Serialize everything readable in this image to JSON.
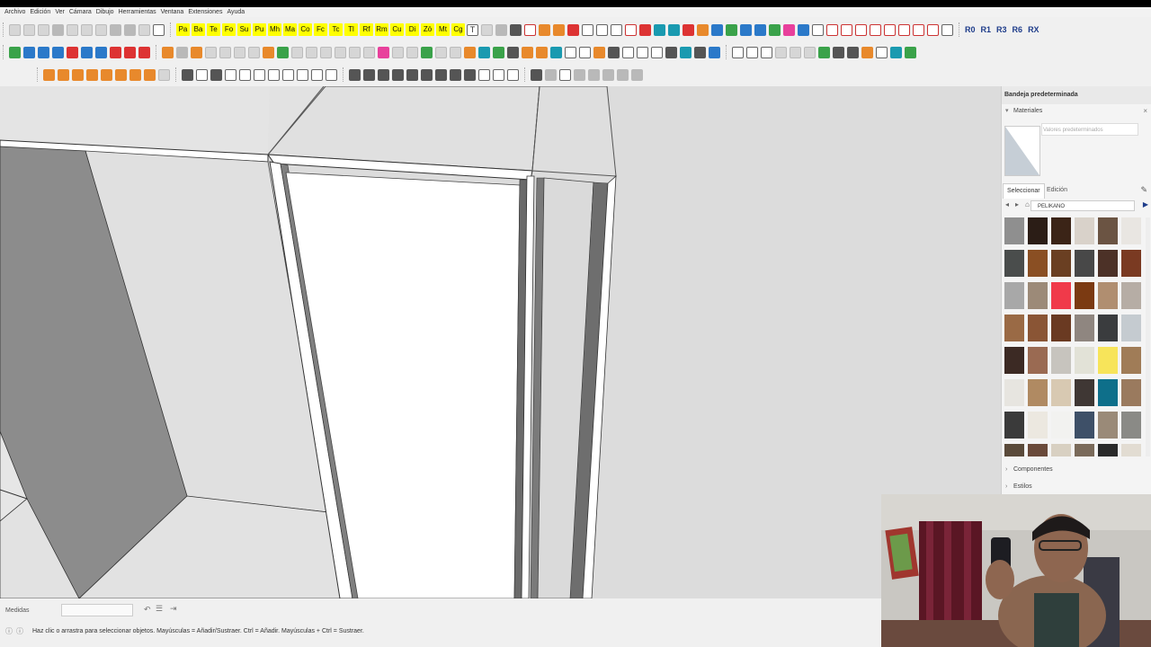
{
  "menu": [
    "Archivo",
    "Edición",
    "Ver",
    "Cámara",
    "Dibujo",
    "Herramientas",
    "Ventana",
    "Extensiones",
    "Ayuda"
  ],
  "toolbar": {
    "plugin_buttons": [
      "Pa",
      "Ba",
      "Te",
      "Fo",
      "Su",
      "Pu",
      "Mh",
      "Ma",
      "Co",
      "Fc",
      "Tc",
      "Tl",
      "Rf",
      "Rm",
      "Cu",
      "Di",
      "Zö",
      "Mt",
      "Cg"
    ],
    "text_tool_label": "T",
    "right_buttons": [
      "R0",
      "R1",
      "R3",
      "R6",
      "RX"
    ]
  },
  "tray": {
    "title": "Bandeja predeterminada",
    "materials_section": "Materiales",
    "material_name_placeholder": "Valores predeterminados",
    "tab_select": "Seleccionar",
    "tab_edit": "Edición",
    "library": "PELIKANO",
    "components_section": "Componentes",
    "styles_section": "Estilos",
    "swatches": [
      "#8f8f8f",
      "#2b1d16",
      "#3b2417",
      "#d9d2ca",
      "#6b5443",
      "#e9e6e2",
      "#4a4d4c",
      "#8a4f23",
      "#6a3f22",
      "#484848",
      "#4c3127",
      "#7a3a22",
      "#a8a8a8",
      "#9c8a78",
      "#f03a4a",
      "#7b3a12",
      "#b08e70",
      "#b6ada5",
      "#9a6a45",
      "#8a5535",
      "#6a3a22",
      "#8f8680",
      "#3a3c3e",
      "#c5cbd0",
      "#3c2a24",
      "#9a6a52",
      "#c7c4be",
      "#e2e2d7",
      "#f7e45a",
      "#a07c57",
      "#e7e5e0",
      "#b08a62",
      "#d8c9b2",
      "#3f3734",
      "#0e6f8a",
      "#9a7a5e",
      "#3a3a3a",
      "#ece8e0",
      "#f2f2f0",
      "#3e5068",
      "#9a8a78",
      "#8a8a86",
      "#5a4a3a",
      "#6a4a3a",
      "#d8d0c2",
      "#7a6a5a",
      "#2a2a2a",
      "#e2dcd2"
    ]
  },
  "status": {
    "measures_label": "Medidas",
    "hint": "Haz clic o arrastra para seleccionar objetos. Mayúsculas = Añadir/Sustraer. Ctrl = Añadir. Mayúsculas + Ctrl = Sustraer."
  },
  "colors": {
    "plugin_button": "#ffff00",
    "viewport_background": "#dcdcdc",
    "model_face_light": "#e2e2e2",
    "model_face_dark": "#8c8c8c",
    "door_face": "#ffffff"
  }
}
